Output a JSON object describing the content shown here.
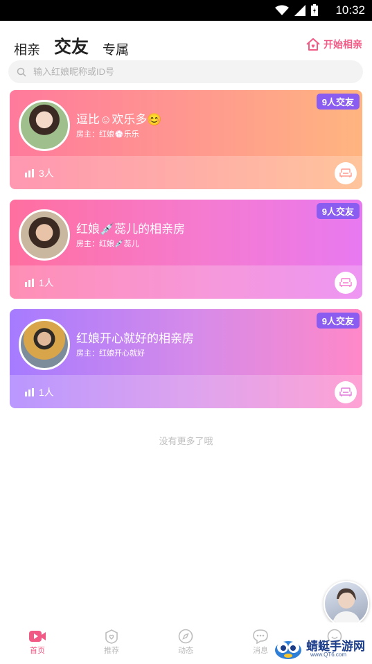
{
  "status_bar": {
    "time": "10:32"
  },
  "header": {
    "tabs": [
      {
        "label": "相亲"
      },
      {
        "label": "交友"
      },
      {
        "label": "专属"
      }
    ],
    "start_button": "开始相亲"
  },
  "search": {
    "placeholder": "输入红娘昵称或ID号"
  },
  "rooms": [
    {
      "title": "逗比☺欢乐多😊",
      "host": "房主：红娘💮乐乐",
      "badge": "9人交友",
      "count": "3人"
    },
    {
      "title": "红娘💉蕊儿的相亲房",
      "host": "房主：红娘💉蕊儿",
      "badge": "9人交友",
      "count": "1人"
    },
    {
      "title": "红娘开心就好的相亲房",
      "host": "房主：红娘开心就好",
      "badge": "9人交友",
      "count": "1人"
    }
  ],
  "no_more_text": "没有更多了哦",
  "bottom_nav": [
    {
      "label": "首页",
      "icon": "video-play-icon"
    },
    {
      "label": "推荐",
      "icon": "heart-shield-icon"
    },
    {
      "label": "动态",
      "icon": "compass-icon"
    },
    {
      "label": "消息",
      "icon": "chat-bubble-icon"
    },
    {
      "label": "",
      "icon": "smile-icon"
    }
  ],
  "watermark": {
    "name": "蜻蜓手游网",
    "url": "www.QT6.com"
  },
  "colors": {
    "accent": "#f25a86",
    "badge": "#8a5cf0",
    "card1": [
      "#ff7a9c",
      "#ffb580"
    ],
    "card2": [
      "#ff6f9f",
      "#e879f0"
    ],
    "card3": [
      "#a67bff",
      "#ff88c8"
    ]
  }
}
